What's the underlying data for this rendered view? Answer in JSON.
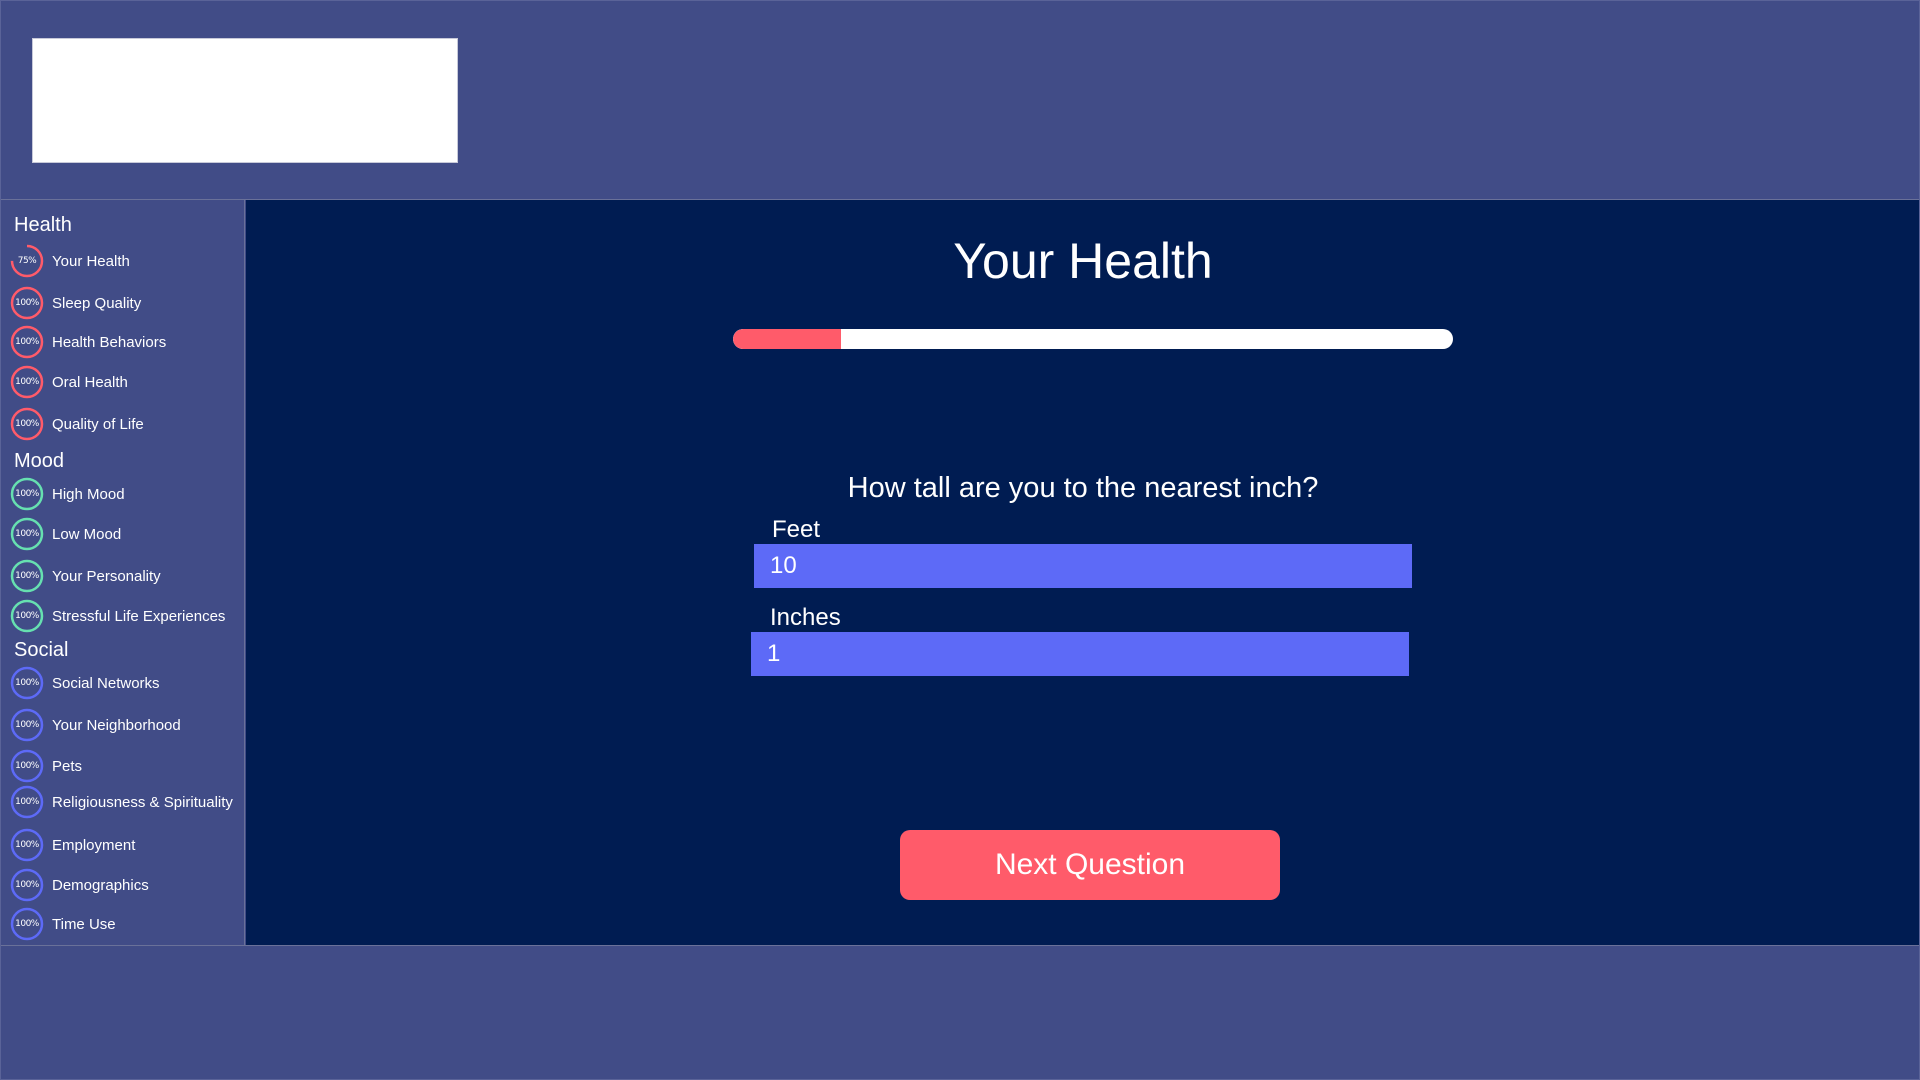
{
  "colors": {
    "background": "#414c87",
    "main_panel": "#001c52",
    "accent_red": "#ff5b6a",
    "accent_green": "#66e0b0",
    "accent_blue": "#5d6af7",
    "input_bg": "#5d6af7"
  },
  "sidebar": {
    "sections": [
      {
        "title": "Health",
        "color": "#ff5b6a",
        "items": [
          {
            "label": "Your Health",
            "percent": 75,
            "percent_text": "75%"
          },
          {
            "label": "Sleep Quality",
            "percent": 100,
            "percent_text": "100%"
          },
          {
            "label": "Health Behaviors",
            "percent": 100,
            "percent_text": "100%"
          },
          {
            "label": "Oral Health",
            "percent": 100,
            "percent_text": "100%"
          },
          {
            "label": "Quality of Life",
            "percent": 100,
            "percent_text": "100%"
          }
        ]
      },
      {
        "title": "Mood",
        "color": "#66e0b0",
        "items": [
          {
            "label": "High Mood",
            "percent": 100,
            "percent_text": "100%"
          },
          {
            "label": "Low Mood",
            "percent": 100,
            "percent_text": "100%"
          },
          {
            "label": "Your Personality",
            "percent": 100,
            "percent_text": "100%"
          },
          {
            "label": "Stressful Life Experiences",
            "percent": 100,
            "percent_text": "100%"
          }
        ]
      },
      {
        "title": "Social",
        "color": "#5d6af7",
        "items": [
          {
            "label": "Social Networks",
            "percent": 100,
            "percent_text": "100%"
          },
          {
            "label": "Your Neighborhood",
            "percent": 100,
            "percent_text": "100%"
          },
          {
            "label": "Pets",
            "percent": 100,
            "percent_text": "100%"
          },
          {
            "label": "Religiousness & Spirituality",
            "percent": 100,
            "percent_text": "100%"
          },
          {
            "label": "Employment",
            "percent": 100,
            "percent_text": "100%"
          },
          {
            "label": "Demographics",
            "percent": 100,
            "percent_text": "100%"
          },
          {
            "label": "Time Use",
            "percent": 100,
            "percent_text": "100%"
          }
        ]
      }
    ]
  },
  "main": {
    "title": "Your Health",
    "progress_fraction": 0.15,
    "question": "How tall are you to the nearest inch?",
    "fields": {
      "feet": {
        "label": "Feet",
        "value": "10"
      },
      "inches": {
        "label": "Inches",
        "value": "1"
      }
    },
    "next_button_label": "Next Question"
  }
}
